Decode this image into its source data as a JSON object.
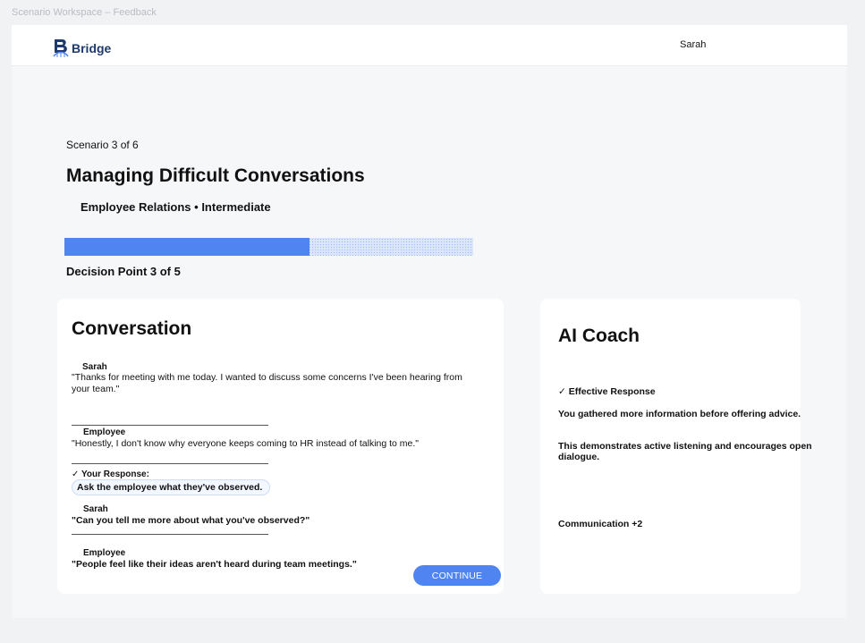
{
  "window_title": "Scenario Workspace – Feedback",
  "header": {
    "logo_text": "Bridge",
    "user_name": "Sarah"
  },
  "scenario": {
    "count_label": "Scenario 3 of 6",
    "title": "Managing Difficult Conversations",
    "subtitle": "Employee Relations • Intermediate",
    "progress_fraction": 0.6,
    "decision_label": "Decision Point 3 of 5"
  },
  "conversation": {
    "title": "Conversation",
    "messages": [
      {
        "speaker": "Sarah",
        "text": "\"Thanks for meeting with me today. I wanted to discuss some concerns I've been hearing from your team.\""
      },
      {
        "speaker": "Employee",
        "text": "\"Honestly, I don't know why everyone keeps coming to HR instead of talking to me.\""
      },
      {
        "speaker": "Sarah",
        "text": "\"Can you tell me more about what you've observed?\""
      },
      {
        "speaker": "Employee",
        "text": "\"People feel like their ideas aren't heard during team meetings.\""
      }
    ],
    "your_response_label": "✓ Your Response:",
    "your_response_text": "Ask the employee what they've observed.",
    "continue_label": "CONTINUE"
  },
  "coach": {
    "title": "AI Coach",
    "verdict": "✓ Effective Response",
    "feedback_1": "You gathered more information before offering advice.",
    "feedback_2": "This demonstrates active listening and encourages open dialogue.",
    "skill_delta": "Communication +2"
  },
  "colors": {
    "accent": "#4f84f1",
    "brand": "#1f3a6b"
  }
}
